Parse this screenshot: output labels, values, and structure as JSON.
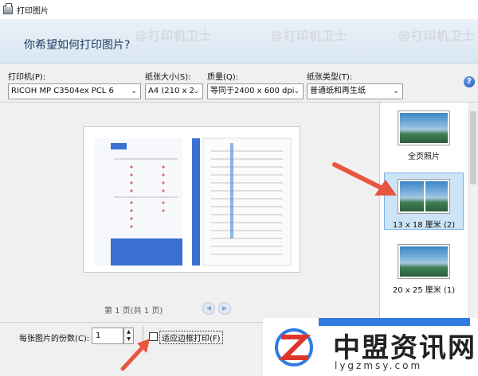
{
  "window": {
    "title": "打印图片"
  },
  "header": {
    "question": "你希望如何打印图片?"
  },
  "watermark": "@打印机卫士",
  "controls": {
    "printer": {
      "label": "打印机(P):",
      "value": "RICOH MP C3504ex PCL 6"
    },
    "paper_size": {
      "label": "纸张大小(S):",
      "value": "A4 (210 x 2"
    },
    "quality": {
      "label": "质量(Q):",
      "value": "等同于2400 x 600 dpi"
    },
    "paper_type": {
      "label": "纸张类型(T):",
      "value": "普通纸和再生纸"
    },
    "help": "?"
  },
  "preview": {
    "page_info": "第 1 页(共 1 页)"
  },
  "bottom": {
    "copies_label": "每张图片的份数(C):",
    "copies_value": "1",
    "fit_label": "适应边框打印(F)"
  },
  "layouts": [
    {
      "label": "全页照片"
    },
    {
      "label": "13 x 18 厘米 (2)"
    },
    {
      "label": "20 x 25 厘米 (1)"
    }
  ],
  "brand": {
    "name": "中盟资讯网",
    "url": "lygzmsy.com"
  },
  "colors": {
    "accent": "#2f7be0",
    "annotation_arrow": "#e8563f"
  }
}
